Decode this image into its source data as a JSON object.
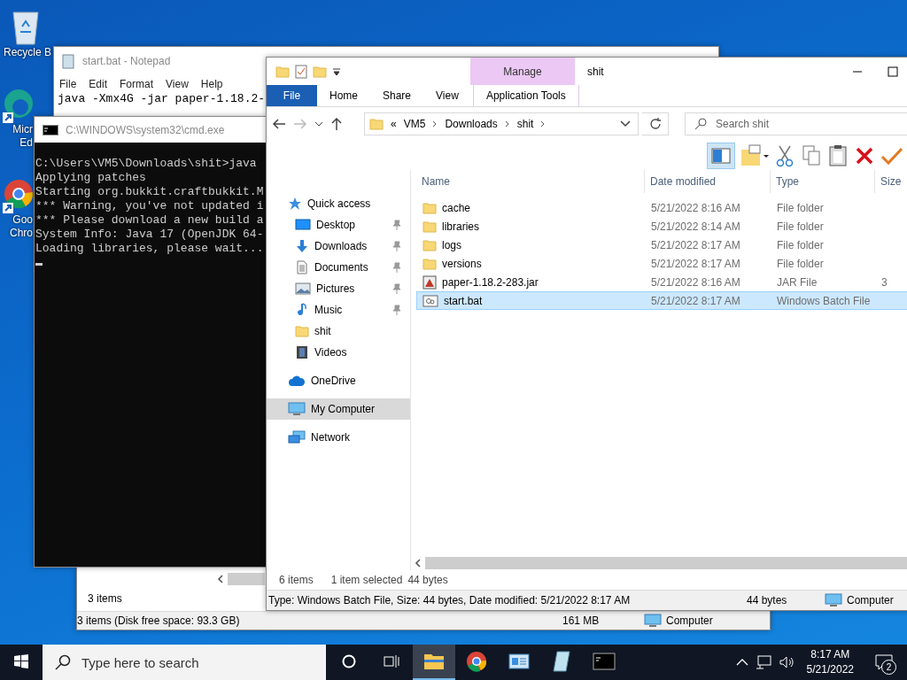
{
  "desktop_icons": [
    {
      "kind": "recycle",
      "lines": [
        "Recycle B"
      ]
    },
    {
      "kind": "edge",
      "lines": [
        "Micr",
        "Ed"
      ]
    },
    {
      "kind": "chrome",
      "lines": [
        "Goo",
        "Chro"
      ]
    }
  ],
  "folder_window": {
    "items_count": "3 items",
    "status": "3 items (Disk free space: 93.3 GB)",
    "size": "161 MB",
    "location": "Computer"
  },
  "notepad": {
    "title": "start.bat - Notepad",
    "menu": [
      "File",
      "Edit",
      "Format",
      "View",
      "Help"
    ],
    "lines": [
      "java -Xmx4G -jar paper-1.18.2-"
    ]
  },
  "cmd": {
    "title": "C:\\WINDOWS\\system32\\cmd.exe",
    "lines": [
      "C:\\Users\\VM5\\Downloads\\shit>java",
      "Applying patches",
      "Starting org.bukkit.craftbukkit.M",
      "*** Warning, you've not updated i",
      "*** Please download a new build a",
      "System Info: Java 17 (OpenJDK 64-",
      "Loading libraries, please wait..."
    ]
  },
  "explorer": {
    "title": "shit",
    "ribbon": {
      "context_group": "Manage",
      "tabs": [
        {
          "kind": "file",
          "label": "File"
        },
        {
          "kind": "tab",
          "label": "Home"
        },
        {
          "kind": "tab",
          "label": "Share"
        },
        {
          "kind": "tab",
          "label": "View"
        },
        {
          "kind": "context",
          "label": "Application Tools"
        }
      ]
    },
    "address": {
      "overflow": "«",
      "crumbs": [
        "VM5",
        "Downloads",
        "shit"
      ]
    },
    "search": {
      "placeholder": "Search shit"
    },
    "preview_pane": {
      "selected": true
    },
    "nav": [
      {
        "kind": "star",
        "label": "Quick access",
        "selected": false,
        "children": [
          {
            "kind": "desktop",
            "label": "Desktop",
            "pinned": true,
            "selected": false
          },
          {
            "kind": "download",
            "label": "Downloads",
            "pinned": true,
            "selected": false
          },
          {
            "kind": "document",
            "label": "Documents",
            "pinned": true,
            "selected": false
          },
          {
            "kind": "pictures",
            "label": "Pictures",
            "pinned": true,
            "selected": false
          },
          {
            "kind": "music",
            "label": "Music",
            "pinned": true,
            "selected": false
          },
          {
            "kind": "folder",
            "label": "shit",
            "pinned": false,
            "selected": false
          },
          {
            "kind": "videos",
            "label": "Videos",
            "pinned": false,
            "selected": false
          }
        ]
      },
      {
        "kind": "cloud",
        "label": "OneDrive",
        "selected": false
      },
      {
        "kind": "computer",
        "label": "My Computer",
        "selected": true
      },
      {
        "kind": "network",
        "label": "Network",
        "selected": false
      }
    ],
    "columns": [
      "Name",
      "Date modified",
      "Type",
      "Size"
    ],
    "files": [
      {
        "kind": "folder",
        "name": "cache",
        "date": "5/21/2022 8:16 AM",
        "type": "File folder",
        "selected": false
      },
      {
        "kind": "folder",
        "name": "libraries",
        "date": "5/21/2022 8:14 AM",
        "type": "File folder",
        "selected": false
      },
      {
        "kind": "folder",
        "name": "logs",
        "date": "5/21/2022 8:17 AM",
        "type": "File folder",
        "selected": false
      },
      {
        "kind": "folder",
        "name": "versions",
        "date": "5/21/2022 8:17 AM",
        "type": "File folder",
        "selected": false
      },
      {
        "kind": "jar",
        "name": "paper-1.18.2-283.jar",
        "date": "5/21/2022 8:16 AM",
        "type": "JAR File",
        "size": "3",
        "selected": false
      },
      {
        "kind": "bat",
        "name": "start.bat",
        "date": "5/21/2022 8:17 AM",
        "type": "Windows Batch File",
        "selected": true
      }
    ],
    "status": {
      "count": "6 items",
      "selection": "1 item selected",
      "size": "44 bytes"
    },
    "details": {
      "text": "Type: Windows Batch File, Size: 44 bytes, Date modified: 5/21/2022 8:17 AM",
      "size": "44 bytes",
      "location": "Computer"
    }
  },
  "taskbar": {
    "search_placeholder": "Type here to search",
    "apps": [
      {
        "kind": "explorer",
        "active": true
      },
      {
        "kind": "chrome",
        "active": false
      },
      {
        "kind": "app",
        "active": false
      },
      {
        "kind": "notepad",
        "active": false
      },
      {
        "kind": "cmd",
        "active": false
      }
    ],
    "time": "8:17 AM",
    "date": "5/21/2022",
    "notifications": "2"
  }
}
